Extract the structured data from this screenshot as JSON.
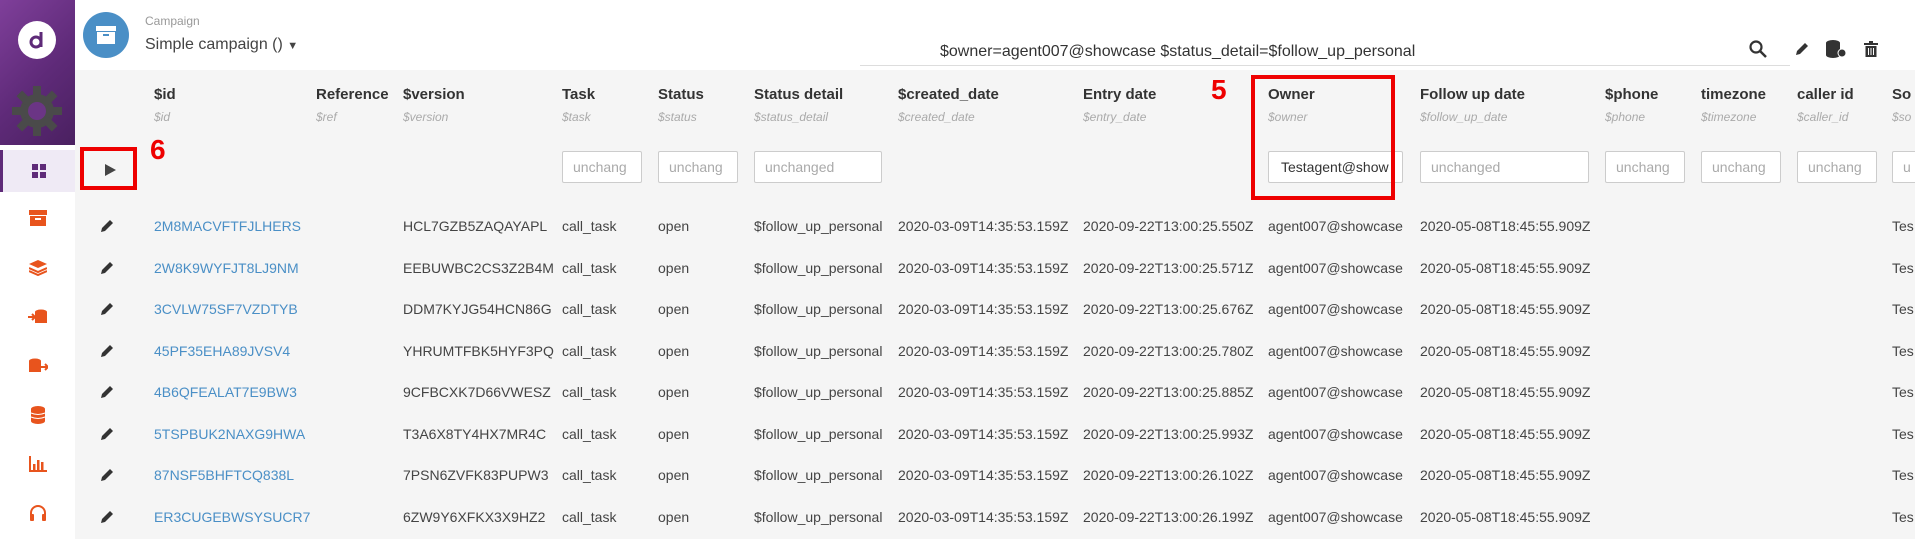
{
  "header": {
    "campaign_label": "Campaign",
    "campaign_name": "Simple campaign ()",
    "query": "$owner=agent007@showcase $status_detail=$follow_up_personal"
  },
  "sidebar": {
    "icons": [
      "dashboard-icon",
      "archive-icon",
      "layers-icon",
      "database-import-icon",
      "database-export-icon",
      "database-icon",
      "bar-chart-icon",
      "headset-icon"
    ],
    "accent": "#e8541d"
  },
  "columns": [
    {
      "label": "$id",
      "sub": "$id",
      "filter": ""
    },
    {
      "label": "Reference",
      "sub": "$ref",
      "filter": ""
    },
    {
      "label": "$version",
      "sub": "$version",
      "filter": ""
    },
    {
      "label": "Task",
      "sub": "$task",
      "filter": "unchang"
    },
    {
      "label": "Status",
      "sub": "$status",
      "filter": "unchang"
    },
    {
      "label": "Status detail",
      "sub": "$status_detail",
      "filter": "unchanged"
    },
    {
      "label": "$created_date",
      "sub": "$created_date",
      "filter": ""
    },
    {
      "label": "Entry date",
      "sub": "$entry_date",
      "filter": ""
    },
    {
      "label": "Owner",
      "sub": "$owner",
      "filter": "Testagent@show"
    },
    {
      "label": "Follow up date",
      "sub": "$follow_up_date",
      "filter": "unchanged"
    },
    {
      "label": "$phone",
      "sub": "$phone",
      "filter": "unchang"
    },
    {
      "label": "timezone",
      "sub": "$timezone",
      "filter": "unchang"
    },
    {
      "label": "caller id",
      "sub": "$caller_id",
      "filter": "unchang"
    },
    {
      "label": "So",
      "sub": "$so",
      "filter": "u"
    }
  ],
  "rows": [
    {
      "id": "2M8MACVFTFJLHERS",
      "version": "HCL7GZB5ZAQAYAPL",
      "task": "call_task",
      "status": "open",
      "status_detail": "$follow_up_personal",
      "created": "2020-03-09T14:35:53.159Z",
      "entry": "2020-09-22T13:00:25.550Z",
      "owner": "agent007@showcase",
      "follow_up": "2020-05-08T18:45:55.909Z",
      "src": "Tes"
    },
    {
      "id": "2W8K9WYFJT8LJ9NM",
      "version": "EEBUWBC2CS3Z2B4M",
      "task": "call_task",
      "status": "open",
      "status_detail": "$follow_up_personal",
      "created": "2020-03-09T14:35:53.159Z",
      "entry": "2020-09-22T13:00:25.571Z",
      "owner": "agent007@showcase",
      "follow_up": "2020-05-08T18:45:55.909Z",
      "src": "Tes"
    },
    {
      "id": "3CVLW75SF7VZDTYB",
      "version": "DDM7KYJG54HCN86G",
      "task": "call_task",
      "status": "open",
      "status_detail": "$follow_up_personal",
      "created": "2020-03-09T14:35:53.159Z",
      "entry": "2020-09-22T13:00:25.676Z",
      "owner": "agent007@showcase",
      "follow_up": "2020-05-08T18:45:55.909Z",
      "src": "Tes"
    },
    {
      "id": "45PF35EHA89JVSV4",
      "version": "YHRUMTFBK5HYF3PQ",
      "task": "call_task",
      "status": "open",
      "status_detail": "$follow_up_personal",
      "created": "2020-03-09T14:35:53.159Z",
      "entry": "2020-09-22T13:00:25.780Z",
      "owner": "agent007@showcase",
      "follow_up": "2020-05-08T18:45:55.909Z",
      "src": "Tes"
    },
    {
      "id": "4B6QFEALAT7E9BW3",
      "version": "9CFBCXK7D66VWESZ",
      "task": "call_task",
      "status": "open",
      "status_detail": "$follow_up_personal",
      "created": "2020-03-09T14:35:53.159Z",
      "entry": "2020-09-22T13:00:25.885Z",
      "owner": "agent007@showcase",
      "follow_up": "2020-05-08T18:45:55.909Z",
      "src": "Tes"
    },
    {
      "id": "5TSPBUK2NAXG9HWA",
      "version": "T3A6X8TY4HX7MR4C",
      "task": "call_task",
      "status": "open",
      "status_detail": "$follow_up_personal",
      "created": "2020-03-09T14:35:53.159Z",
      "entry": "2020-09-22T13:00:25.993Z",
      "owner": "agent007@showcase",
      "follow_up": "2020-05-08T18:45:55.909Z",
      "src": "Tes"
    },
    {
      "id": "87NSF5BHFTCQ838L",
      "version": "7PSN6ZVFK83PUPW3",
      "task": "call_task",
      "status": "open",
      "status_detail": "$follow_up_personal",
      "created": "2020-03-09T14:35:53.159Z",
      "entry": "2020-09-22T13:00:26.102Z",
      "owner": "agent007@showcase",
      "follow_up": "2020-05-08T18:45:55.909Z",
      "src": "Tes"
    },
    {
      "id": "ER3CUGEBWSYSUCR7",
      "version": "6ZW9Y6XFKX3X9HZ2",
      "task": "call_task",
      "status": "open",
      "status_detail": "$follow_up_personal",
      "created": "2020-03-09T14:35:53.159Z",
      "entry": "2020-09-22T13:00:26.199Z",
      "owner": "agent007@showcase",
      "follow_up": "2020-05-08T18:45:55.909Z",
      "src": "Tes"
    }
  ],
  "annotations": [
    {
      "number": "5",
      "target": "Owner column"
    },
    {
      "number": "6",
      "target": "play button"
    }
  ],
  "colors": {
    "link": "#4a8fc6",
    "brand": "#5e2a78",
    "annotation": "#ee0000"
  }
}
